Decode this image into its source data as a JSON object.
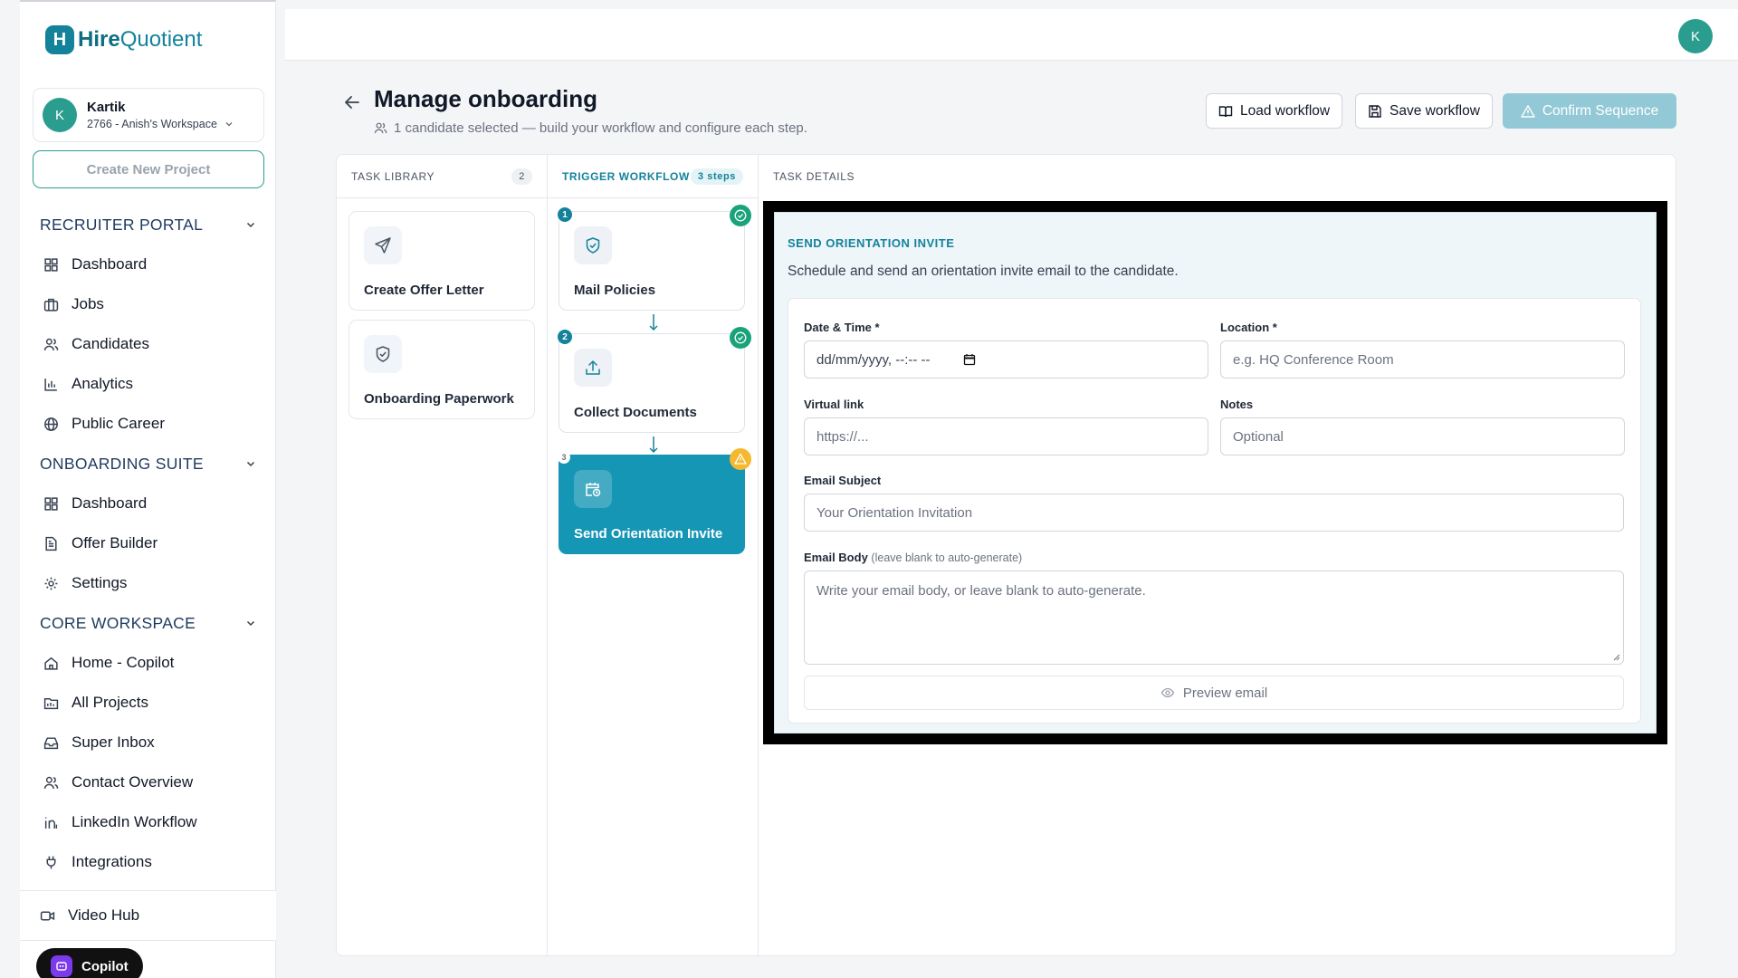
{
  "app": {
    "logo_mark": "H",
    "logo_bold": "Hire",
    "logo_light": "Quotient"
  },
  "workspace": {
    "avatar": "K",
    "name": "Kartik",
    "subtitle": "2766 - Anish's Workspace"
  },
  "create_project_label": "Create New Project",
  "sections": [
    {
      "title": "RECRUITER PORTAL",
      "items": [
        {
          "label": "Dashboard",
          "icon": "grid-icon"
        },
        {
          "label": "Jobs",
          "icon": "briefcase-icon"
        },
        {
          "label": "Candidates",
          "icon": "users-icon"
        },
        {
          "label": "Analytics",
          "icon": "bar-chart-icon"
        },
        {
          "label": "Public Career",
          "icon": "globe-icon"
        }
      ]
    },
    {
      "title": "ONBOARDING SUITE",
      "items": [
        {
          "label": "Dashboard",
          "icon": "grid-icon"
        },
        {
          "label": "Offer Builder",
          "icon": "document-icon"
        },
        {
          "label": "Settings",
          "icon": "gear-icon"
        }
      ]
    },
    {
      "title": "CORE WORKSPACE",
      "items": [
        {
          "label": "Home - Copilot",
          "icon": "home-icon"
        },
        {
          "label": "All Projects",
          "icon": "folder-icon"
        },
        {
          "label": "Super Inbox",
          "icon": "inbox-icon"
        },
        {
          "label": "Contact Overview",
          "icon": "users-icon"
        },
        {
          "label": "LinkedIn Workflow",
          "icon": "linkedin-icon"
        },
        {
          "label": "Integrations",
          "icon": "plug-icon"
        }
      ]
    }
  ],
  "bottom_item": {
    "label": "Video Hub",
    "icon": "video-icon"
  },
  "copilot_label": "Copilot",
  "topbar": {
    "avatar": "K"
  },
  "header": {
    "title": "Manage onboarding",
    "subtitle": "1 candidate selected — build your workflow and configure each step.",
    "load_label": "Load workflow",
    "save_label": "Save workflow",
    "confirm_label": "Confirm Sequence"
  },
  "task_library": {
    "title": "TASK LIBRARY",
    "count": "2",
    "cards": [
      {
        "label": "Create Offer Letter",
        "icon": "send-icon"
      },
      {
        "label": "Onboarding Paperwork",
        "icon": "shield-icon"
      }
    ]
  },
  "trigger_workflow": {
    "title": "TRIGGER WORKFLOW",
    "steps_label": "3 steps",
    "steps": [
      {
        "num": "1",
        "label": "Mail Policies",
        "icon": "shield-icon",
        "status": "complete"
      },
      {
        "num": "2",
        "label": "Collect Documents",
        "icon": "upload-icon",
        "status": "complete"
      },
      {
        "num": "3",
        "label": "Send Orientation Invite",
        "icon": "calendar-clock-icon",
        "status": "warning"
      }
    ]
  },
  "task_details": {
    "title": "TASK DETAILS",
    "heading": "SEND ORIENTATION INVITE",
    "description": "Schedule and send an orientation invite email to the candidate.",
    "fields": {
      "datetime_label": "Date & Time *",
      "datetime_value": "dd/mm/yyyy, --:-- --",
      "location_label": "Location *",
      "location_placeholder": "e.g. HQ Conference Room",
      "virtual_label": "Virtual link",
      "virtual_placeholder": "https://...",
      "notes_label": "Notes",
      "notes_placeholder": "Optional",
      "subject_label": "Email Subject",
      "subject_placeholder": "Your Orientation Invitation",
      "body_label": "Email Body",
      "body_hint": "(leave blank to auto-generate)",
      "body_placeholder": "Write your email body, or leave blank to auto-generate."
    },
    "preview_label": "Preview email"
  },
  "colors": {
    "brand": "#14829b",
    "active_step": "#1696b5",
    "ok": "#1aa37a",
    "warn": "#f5b82e"
  }
}
